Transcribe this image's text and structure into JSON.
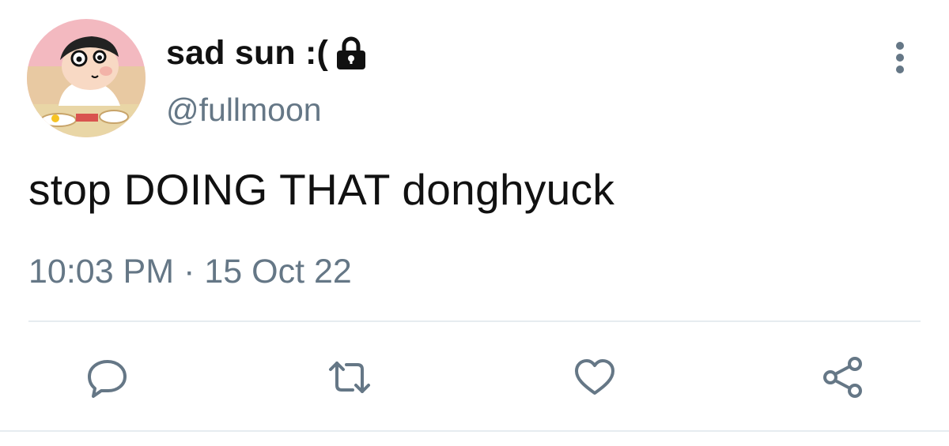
{
  "tweet": {
    "author": {
      "display_name": "sad sun :(",
      "handle": "@fullmoon",
      "protected_icon": "lock-icon",
      "avatar": "avatar"
    },
    "text": "stop DOING THAT donghyuck",
    "time": "10:03 PM",
    "separator": "·",
    "date": "15 Oct 22",
    "actions": [
      "reply-icon",
      "retweet-icon",
      "like-icon",
      "share-icon"
    ],
    "menu_icon": "more-vertical-icon"
  },
  "colors": {
    "text": "#111111",
    "secondary": "#657786",
    "divider": "#e6ecf0"
  }
}
